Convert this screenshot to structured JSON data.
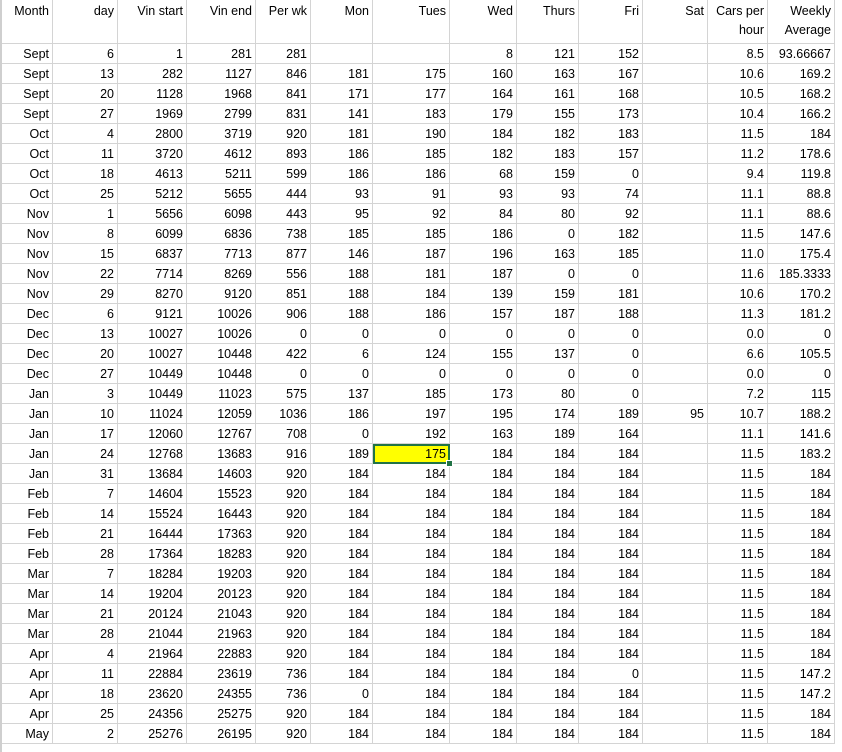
{
  "headers": [
    "Month",
    "day",
    "Vin start",
    "Vin end",
    "Per wk",
    "Mon",
    "Tues",
    "Wed",
    "Thurs",
    "Fri",
    "Sat",
    "Cars per hour",
    "Weekly Average"
  ],
  "rows": [
    [
      "Sept",
      "6",
      "1",
      "281",
      "281",
      "",
      "",
      "8",
      "121",
      "152",
      "",
      "8.5",
      "93.66667"
    ],
    [
      "Sept",
      "13",
      "282",
      "1127",
      "846",
      "181",
      "175",
      "160",
      "163",
      "167",
      "",
      "10.6",
      "169.2"
    ],
    [
      "Sept",
      "20",
      "1128",
      "1968",
      "841",
      "171",
      "177",
      "164",
      "161",
      "168",
      "",
      "10.5",
      "168.2"
    ],
    [
      "Sept",
      "27",
      "1969",
      "2799",
      "831",
      "141",
      "183",
      "179",
      "155",
      "173",
      "",
      "10.4",
      "166.2"
    ],
    [
      "Oct",
      "4",
      "2800",
      "3719",
      "920",
      "181",
      "190",
      "184",
      "182",
      "183",
      "",
      "11.5",
      "184"
    ],
    [
      "Oct",
      "11",
      "3720",
      "4612",
      "893",
      "186",
      "185",
      "182",
      "183",
      "157",
      "",
      "11.2",
      "178.6"
    ],
    [
      "Oct",
      "18",
      "4613",
      "5211",
      "599",
      "186",
      "186",
      "68",
      "159",
      "0",
      "",
      "9.4",
      "119.8"
    ],
    [
      "Oct",
      "25",
      "5212",
      "5655",
      "444",
      "93",
      "91",
      "93",
      "93",
      "74",
      "",
      "11.1",
      "88.8"
    ],
    [
      "Nov",
      "1",
      "5656",
      "6098",
      "443",
      "95",
      "92",
      "84",
      "80",
      "92",
      "",
      "11.1",
      "88.6"
    ],
    [
      "Nov",
      "8",
      "6099",
      "6836",
      "738",
      "185",
      "185",
      "186",
      "0",
      "182",
      "",
      "11.5",
      "147.6"
    ],
    [
      "Nov",
      "15",
      "6837",
      "7713",
      "877",
      "146",
      "187",
      "196",
      "163",
      "185",
      "",
      "11.0",
      "175.4"
    ],
    [
      "Nov",
      "22",
      "7714",
      "8269",
      "556",
      "188",
      "181",
      "187",
      "0",
      "0",
      "",
      "11.6",
      "185.3333"
    ],
    [
      "Nov",
      "29",
      "8270",
      "9120",
      "851",
      "188",
      "184",
      "139",
      "159",
      "181",
      "",
      "10.6",
      "170.2"
    ],
    [
      "Dec",
      "6",
      "9121",
      "10026",
      "906",
      "188",
      "186",
      "157",
      "187",
      "188",
      "",
      "11.3",
      "181.2"
    ],
    [
      "Dec",
      "13",
      "10027",
      "10026",
      "0",
      "0",
      "0",
      "0",
      "0",
      "0",
      "",
      "0.0",
      "0"
    ],
    [
      "Dec",
      "20",
      "10027",
      "10448",
      "422",
      "6",
      "124",
      "155",
      "137",
      "0",
      "",
      "6.6",
      "105.5"
    ],
    [
      "Dec",
      "27",
      "10449",
      "10448",
      "0",
      "0",
      "0",
      "0",
      "0",
      "0",
      "",
      "0.0",
      "0"
    ],
    [
      "Jan",
      "3",
      "10449",
      "11023",
      "575",
      "137",
      "185",
      "173",
      "80",
      "0",
      "",
      "7.2",
      "115"
    ],
    [
      "Jan",
      "10",
      "11024",
      "12059",
      "1036",
      "186",
      "197",
      "195",
      "174",
      "189",
      "95",
      "10.7",
      "188.2"
    ],
    [
      "Jan",
      "17",
      "12060",
      "12767",
      "708",
      "0",
      "192",
      "163",
      "189",
      "164",
      "",
      "11.1",
      "141.6"
    ],
    [
      "Jan",
      "24",
      "12768",
      "13683",
      "916",
      "189",
      "175",
      "184",
      "184",
      "184",
      "",
      "11.5",
      "183.2"
    ],
    [
      "Jan",
      "31",
      "13684",
      "14603",
      "920",
      "184",
      "184",
      "184",
      "184",
      "184",
      "",
      "11.5",
      "184"
    ],
    [
      "Feb",
      "7",
      "14604",
      "15523",
      "920",
      "184",
      "184",
      "184",
      "184",
      "184",
      "",
      "11.5",
      "184"
    ],
    [
      "Feb",
      "14",
      "15524",
      "16443",
      "920",
      "184",
      "184",
      "184",
      "184",
      "184",
      "",
      "11.5",
      "184"
    ],
    [
      "Feb",
      "21",
      "16444",
      "17363",
      "920",
      "184",
      "184",
      "184",
      "184",
      "184",
      "",
      "11.5",
      "184"
    ],
    [
      "Feb",
      "28",
      "17364",
      "18283",
      "920",
      "184",
      "184",
      "184",
      "184",
      "184",
      "",
      "11.5",
      "184"
    ],
    [
      "Mar",
      "7",
      "18284",
      "19203",
      "920",
      "184",
      "184",
      "184",
      "184",
      "184",
      "",
      "11.5",
      "184"
    ],
    [
      "Mar",
      "14",
      "19204",
      "20123",
      "920",
      "184",
      "184",
      "184",
      "184",
      "184",
      "",
      "11.5",
      "184"
    ],
    [
      "Mar",
      "21",
      "20124",
      "21043",
      "920",
      "184",
      "184",
      "184",
      "184",
      "184",
      "",
      "11.5",
      "184"
    ],
    [
      "Mar",
      "28",
      "21044",
      "21963",
      "920",
      "184",
      "184",
      "184",
      "184",
      "184",
      "",
      "11.5",
      "184"
    ],
    [
      "Apr",
      "4",
      "21964",
      "22883",
      "920",
      "184",
      "184",
      "184",
      "184",
      "184",
      "",
      "11.5",
      "184"
    ],
    [
      "Apr",
      "11",
      "22884",
      "23619",
      "736",
      "184",
      "184",
      "184",
      "184",
      "0",
      "",
      "11.5",
      "147.2"
    ],
    [
      "Apr",
      "18",
      "23620",
      "24355",
      "736",
      "0",
      "184",
      "184",
      "184",
      "184",
      "",
      "11.5",
      "147.2"
    ],
    [
      "Apr",
      "25",
      "24356",
      "25275",
      "920",
      "184",
      "184",
      "184",
      "184",
      "184",
      "",
      "11.5",
      "184"
    ],
    [
      "May",
      "2",
      "25276",
      "26195",
      "920",
      "184",
      "184",
      "184",
      "184",
      "184",
      "",
      "11.5",
      "184"
    ]
  ],
  "selection": {
    "row": 20,
    "col": 6,
    "fill_color": "#ffff00",
    "border_color": "#217346"
  },
  "gridline_color": "#d4d4d4"
}
